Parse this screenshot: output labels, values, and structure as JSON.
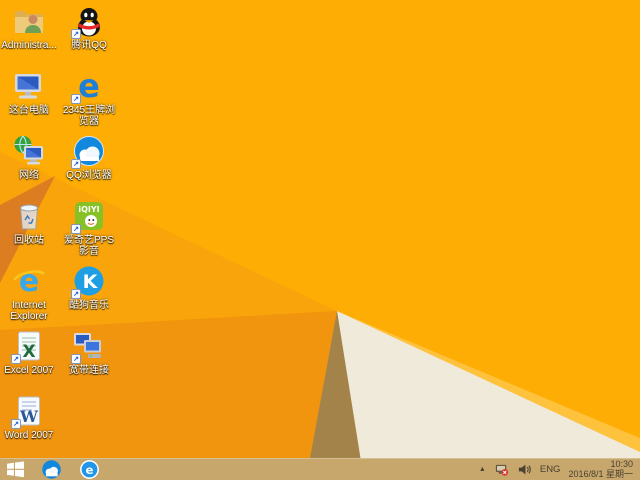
{
  "colors": {
    "wallpaper_base": "#F9A40A",
    "wallpaper_bright": "#FDAD03",
    "wallpaper_lower_left": "#F1950E",
    "wallpaper_dark_wedge": "#DC7D21",
    "wallpaper_ridge": "#FFC23C",
    "wallpaper_white_facet": "#F0EADB",
    "wallpaper_olive_facet": "#A3834A",
    "taskbar_bg": "#C7A76B",
    "taskbar_text": "#4A4034",
    "icon_label_text": "#FFFFFF",
    "shortcut_arrow_blue": "#1E5AD7",
    "network_error_red": "#D43A2F"
  },
  "desktop": {
    "columns": [
      {
        "items": [
          {
            "label": "Administra...",
            "icon": "user-folder-icon"
          },
          {
            "label": "这台电脑",
            "icon": "this-pc-icon"
          },
          {
            "label": "网络",
            "icon": "network-icon"
          },
          {
            "label": "回收站",
            "icon": "recycle-bin-icon"
          },
          {
            "label": "Internet Explorer",
            "icon": "internet-explorer-icon"
          },
          {
            "label": "Excel 2007",
            "icon": "excel-icon"
          },
          {
            "label": "Word 2007",
            "icon": "word-icon"
          }
        ]
      },
      {
        "items": [
          {
            "label": "腾讯QQ",
            "icon": "qq-penguin-icon"
          },
          {
            "label": "2345王牌浏览器",
            "icon": "blue-e-browser-icon"
          },
          {
            "label": "QQ浏览器",
            "icon": "qq-browser-cloud-icon"
          },
          {
            "label": "爱奇艺PPS影音",
            "icon": "iqiyi-pps-icon"
          },
          {
            "label": "酷狗音乐",
            "icon": "kugou-k-icon"
          },
          {
            "label": "宽带连接",
            "icon": "broadband-connection-icon"
          }
        ]
      }
    ],
    "shortcut_glyph": "↗"
  },
  "taskbar": {
    "start": {
      "icon": "windows-logo-icon"
    },
    "pinned": [
      {
        "icon": "qq-browser-cloud-icon"
      },
      {
        "icon": "blue-e-browser-icon"
      }
    ],
    "tray": {
      "hidden_icons_glyph": "▲",
      "icons": [
        "network-disconnected-icon",
        "speaker-icon"
      ],
      "language": "ENG",
      "time": "10:30",
      "date": "2016/8/1 星期一"
    }
  }
}
